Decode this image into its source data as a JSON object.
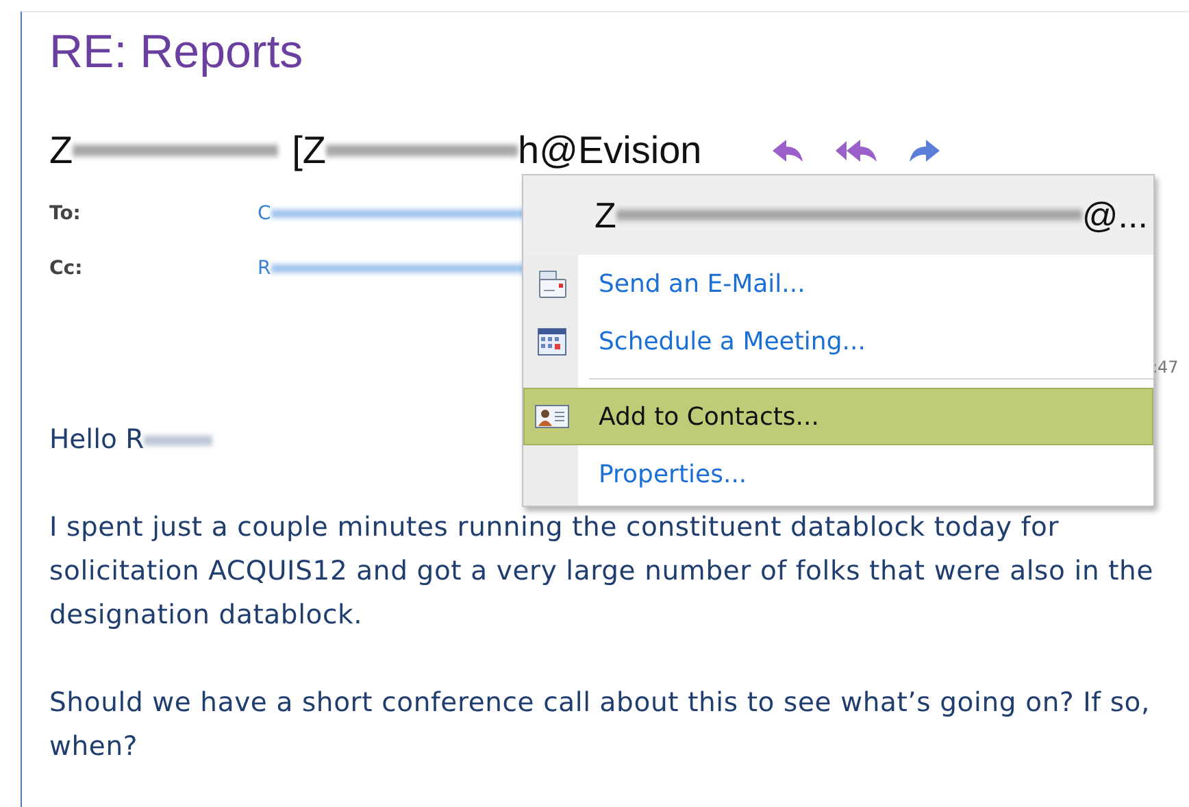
{
  "title": "RE: Reports",
  "sender": {
    "name_start": "Z",
    "address_start": "[Z",
    "address_end": "h@Evision"
  },
  "recipients": [
    {
      "label": "To:",
      "value_start": "C"
    },
    {
      "label": "Cc:",
      "value_start": "R"
    }
  ],
  "time_fragment": ":47",
  "body": {
    "greeting": "Hello R",
    "paragraphs": [
      "I spent just a couple minutes running the constituent datablock today for solicitation ACQUIS12 and got a very large number of folks that were also in the designation datablock.",
      "Should we have a short conference call about this to see what’s going on?  If so, when?"
    ]
  },
  "context_menu": {
    "header_start": "Z",
    "header_end": "@...",
    "items": [
      {
        "kind": "email",
        "label": "Send an E-Mail...",
        "selected": false
      },
      {
        "kind": "meeting",
        "label": "Schedule a Meeting...",
        "selected": false
      },
      {
        "kind": "separator"
      },
      {
        "kind": "contact",
        "label": "Add to Contacts...",
        "selected": true
      },
      {
        "kind": "plain",
        "label": "Properties...",
        "selected": false
      }
    ]
  }
}
